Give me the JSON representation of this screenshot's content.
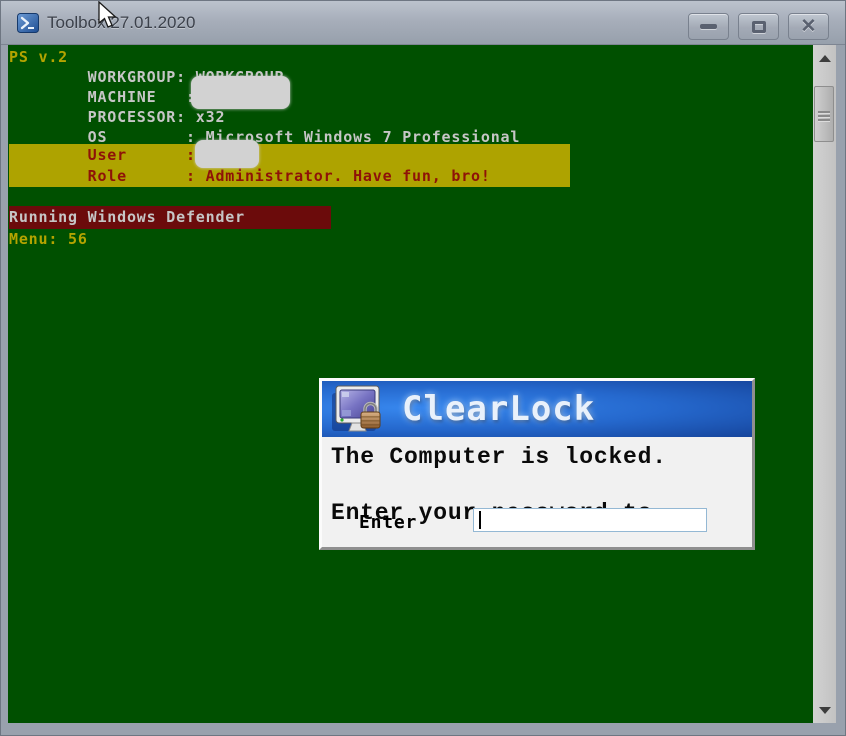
{
  "window": {
    "title": "Toolbox 27.01.2020"
  },
  "console": {
    "ps_version": "PS v.2",
    "workgroup_line": "        WORKGROUP: WORKGROUP",
    "machine_line": "        MACHINE   :",
    "processor_line": "        PROCESSOR: x32",
    "os_line": "        OS        : Microsoft Windows 7 Professional",
    "user_line": "        User      :",
    "role_line": "        Role      : Administrator. Have fun, bro!",
    "defender_status": "Running Windows Defender",
    "menu_line": "Menu: 56"
  },
  "dialog": {
    "app_name": "ClearLock",
    "message_line1": "The Computer is locked.",
    "message_line2": "Enter your password to",
    "enter_label": "Enter",
    "password_value": ""
  },
  "colors": {
    "console_background": "#005000",
    "console_text": "#c6c6c6",
    "accent_yellow": "#b4a400",
    "highlight_olive": "#aea300",
    "alert_text_red": "#8e1208",
    "defender_bar_maroon": "#6b0b0b",
    "dialog_header_blue": "#2568cd",
    "titlebar_gray": "#a7aeba"
  }
}
